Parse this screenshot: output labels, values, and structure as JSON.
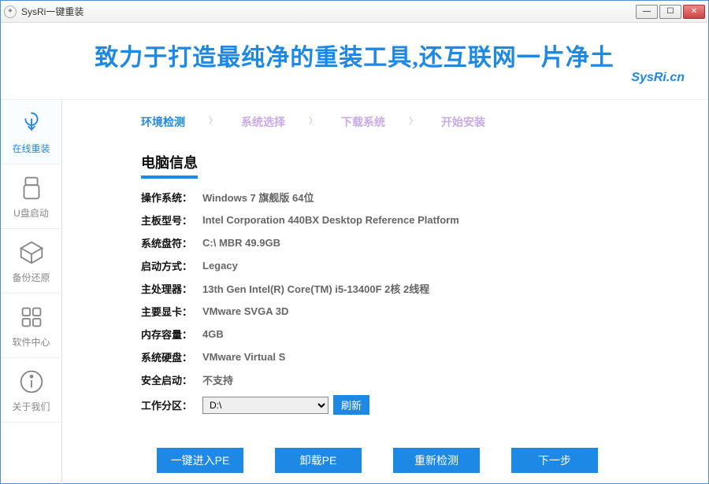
{
  "window": {
    "title": "SysRi一键重装"
  },
  "banner": {
    "slogan": "致力于打造最纯净的重装工具,还互联网一片净土",
    "url": "SysRi.cn"
  },
  "sidebar": {
    "items": [
      {
        "label": "在线重装"
      },
      {
        "label": "U盘启动"
      },
      {
        "label": "备份还原"
      },
      {
        "label": "软件中心"
      },
      {
        "label": "关于我们"
      }
    ]
  },
  "steps": {
    "items": [
      {
        "label": "环境检测"
      },
      {
        "label": "系统选择"
      },
      {
        "label": "下载系统"
      },
      {
        "label": "开始安装"
      }
    ]
  },
  "section": {
    "title": "电脑信息"
  },
  "info": {
    "os_label": "操作系统：",
    "os_value": "Windows 7 旗舰版   64位",
    "mb_label": "主板型号：",
    "mb_value": "Intel Corporation 440BX Desktop Reference Platform",
    "drive_label": "系统盘符：",
    "drive_value": "C:\\ MBR 49.9GB",
    "boot_label": "启动方式：",
    "boot_value": "Legacy",
    "cpu_label": "主处理器：",
    "cpu_value": "13th Gen Intel(R) Core(TM) i5-13400F 2核 2线程",
    "gpu_label": "主要显卡：",
    "gpu_value": "VMware SVGA 3D",
    "ram_label": "内存容量：",
    "ram_value": "4GB",
    "disk_label": "系统硬盘：",
    "disk_value": "VMware Virtual S",
    "secure_label": "安全启动：",
    "secure_value": "不支持",
    "part_label": "工作分区：",
    "part_selected": "D:\\",
    "refresh": "刷新"
  },
  "buttons": {
    "enter_pe": "一键进入PE",
    "uninstall_pe": "卸载PE",
    "recheck": "重新检测",
    "next": "下一步"
  }
}
